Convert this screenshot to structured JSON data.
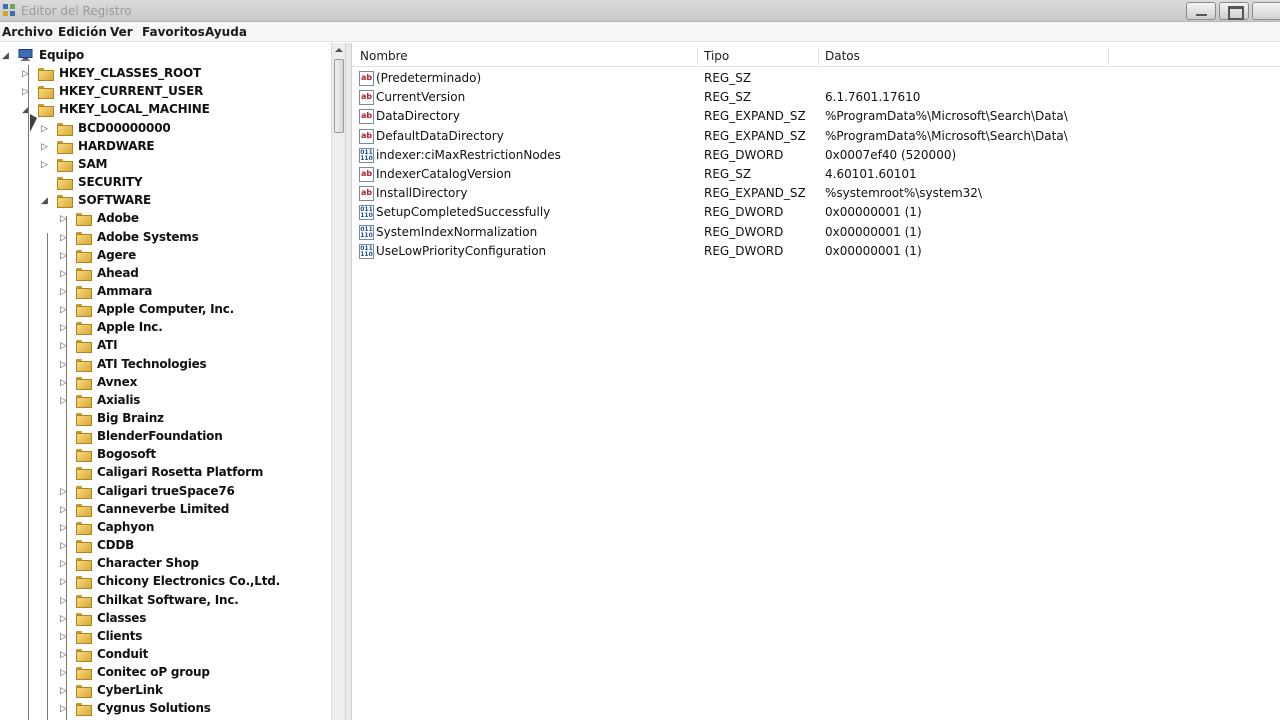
{
  "window": {
    "title": "Editor del Registro"
  },
  "menu": [
    "Archivo",
    "Edición",
    "Ver",
    "Favoritos",
    "Ayuda"
  ],
  "tree": {
    "root": "Equipo",
    "hives": [
      "HKEY_CLASSES_ROOT",
      "HKEY_CURRENT_USER",
      "HKEY_LOCAL_MACHINE"
    ],
    "local_machine": [
      "BCD00000000",
      "HARDWARE",
      "SAM",
      "SECURITY",
      "SOFTWARE"
    ],
    "software": [
      "Adobe",
      "Adobe Systems",
      "Agere",
      "Ahead",
      "Ammara",
      "Apple Computer, Inc.",
      "Apple Inc.",
      "ATI",
      "ATI Technologies",
      "Avnex",
      "Axialis",
      "Big Brainz",
      "BlenderFoundation",
      "Bogosoft",
      "Caligari Rosetta Platform",
      "Caligari trueSpace76",
      "Canneverbe Limited",
      "Caphyon",
      "CDDB",
      "Character Shop",
      "Chicony Electronics Co.,Ltd.",
      "Chilkat Software, Inc.",
      "Classes",
      "Clients",
      "Conduit",
      "Conitec oP group",
      "CyberLink",
      "Cygnus Solutions"
    ]
  },
  "columns": {
    "name": "Nombre",
    "type": "Tipo",
    "data": "Datos"
  },
  "values": [
    {
      "kind": "ab",
      "name": "(Predeterminado)",
      "type": "REG_SZ",
      "data": ""
    },
    {
      "kind": "ab",
      "name": "CurrentVersion",
      "type": "REG_SZ",
      "data": "6.1.7601.17610"
    },
    {
      "kind": "ab",
      "name": "DataDirectory",
      "type": "REG_EXPAND_SZ",
      "data": "%ProgramData%\\Microsoft\\Search\\Data\\"
    },
    {
      "kind": "ab",
      "name": "DefaultDataDirectory",
      "type": "REG_EXPAND_SZ",
      "data": "%ProgramData%\\Microsoft\\Search\\Data\\"
    },
    {
      "kind": "dword",
      "name": "indexer:ciMaxRestrictionNodes",
      "type": "REG_DWORD",
      "data": "0x0007ef40 (520000)"
    },
    {
      "kind": "ab",
      "name": "IndexerCatalogVersion",
      "type": "REG_SZ",
      "data": "4.60101.60101"
    },
    {
      "kind": "ab",
      "name": "InstallDirectory",
      "type": "REG_EXPAND_SZ",
      "data": "%systemroot%\\system32\\"
    },
    {
      "kind": "dword",
      "name": "SetupCompletedSuccessfully",
      "type": "REG_DWORD",
      "data": "0x00000001 (1)"
    },
    {
      "kind": "dword",
      "name": "SystemIndexNormalization",
      "type": "REG_DWORD",
      "data": "0x00000001 (1)"
    },
    {
      "kind": "dword",
      "name": "UseLowPriorityConfiguration",
      "type": "REG_DWORD",
      "data": "0x00000001 (1)"
    }
  ],
  "icons": {
    "app": "regedit-icon",
    "computer": "computer-icon",
    "folder": "folder-icon",
    "string_value": "string-value-icon",
    "binary_value": "dword-value-icon"
  }
}
